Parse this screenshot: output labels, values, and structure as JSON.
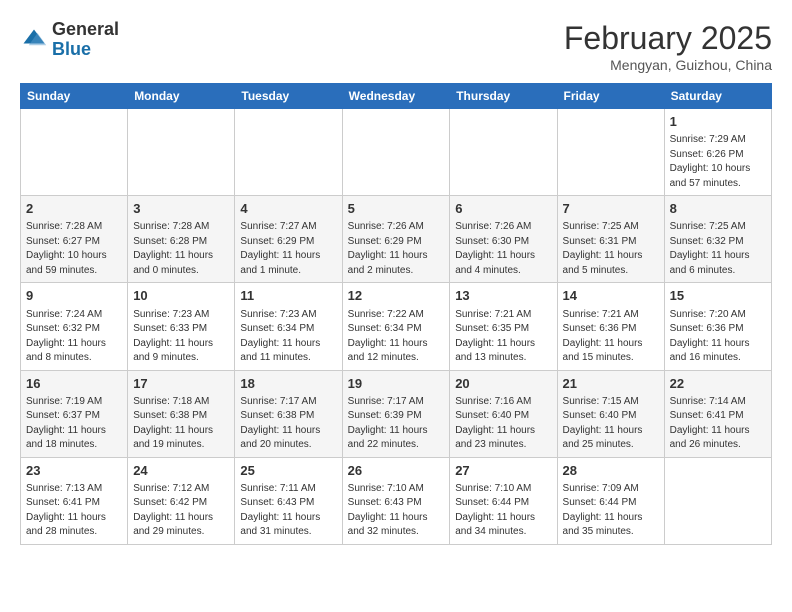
{
  "header": {
    "logo_general": "General",
    "logo_blue": "Blue",
    "title": "February 2025",
    "subtitle": "Mengyan, Guizhou, China"
  },
  "weekdays": [
    "Sunday",
    "Monday",
    "Tuesday",
    "Wednesday",
    "Thursday",
    "Friday",
    "Saturday"
  ],
  "weeks": [
    [
      {
        "day": "",
        "info": ""
      },
      {
        "day": "",
        "info": ""
      },
      {
        "day": "",
        "info": ""
      },
      {
        "day": "",
        "info": ""
      },
      {
        "day": "",
        "info": ""
      },
      {
        "day": "",
        "info": ""
      },
      {
        "day": "1",
        "info": "Sunrise: 7:29 AM\nSunset: 6:26 PM\nDaylight: 10 hours and 57 minutes."
      }
    ],
    [
      {
        "day": "2",
        "info": "Sunrise: 7:28 AM\nSunset: 6:27 PM\nDaylight: 10 hours and 59 minutes."
      },
      {
        "day": "3",
        "info": "Sunrise: 7:28 AM\nSunset: 6:28 PM\nDaylight: 11 hours and 0 minutes."
      },
      {
        "day": "4",
        "info": "Sunrise: 7:27 AM\nSunset: 6:29 PM\nDaylight: 11 hours and 1 minute."
      },
      {
        "day": "5",
        "info": "Sunrise: 7:26 AM\nSunset: 6:29 PM\nDaylight: 11 hours and 2 minutes."
      },
      {
        "day": "6",
        "info": "Sunrise: 7:26 AM\nSunset: 6:30 PM\nDaylight: 11 hours and 4 minutes."
      },
      {
        "day": "7",
        "info": "Sunrise: 7:25 AM\nSunset: 6:31 PM\nDaylight: 11 hours and 5 minutes."
      },
      {
        "day": "8",
        "info": "Sunrise: 7:25 AM\nSunset: 6:32 PM\nDaylight: 11 hours and 6 minutes."
      }
    ],
    [
      {
        "day": "9",
        "info": "Sunrise: 7:24 AM\nSunset: 6:32 PM\nDaylight: 11 hours and 8 minutes."
      },
      {
        "day": "10",
        "info": "Sunrise: 7:23 AM\nSunset: 6:33 PM\nDaylight: 11 hours and 9 minutes."
      },
      {
        "day": "11",
        "info": "Sunrise: 7:23 AM\nSunset: 6:34 PM\nDaylight: 11 hours and 11 minutes."
      },
      {
        "day": "12",
        "info": "Sunrise: 7:22 AM\nSunset: 6:34 PM\nDaylight: 11 hours and 12 minutes."
      },
      {
        "day": "13",
        "info": "Sunrise: 7:21 AM\nSunset: 6:35 PM\nDaylight: 11 hours and 13 minutes."
      },
      {
        "day": "14",
        "info": "Sunrise: 7:21 AM\nSunset: 6:36 PM\nDaylight: 11 hours and 15 minutes."
      },
      {
        "day": "15",
        "info": "Sunrise: 7:20 AM\nSunset: 6:36 PM\nDaylight: 11 hours and 16 minutes."
      }
    ],
    [
      {
        "day": "16",
        "info": "Sunrise: 7:19 AM\nSunset: 6:37 PM\nDaylight: 11 hours and 18 minutes."
      },
      {
        "day": "17",
        "info": "Sunrise: 7:18 AM\nSunset: 6:38 PM\nDaylight: 11 hours and 19 minutes."
      },
      {
        "day": "18",
        "info": "Sunrise: 7:17 AM\nSunset: 6:38 PM\nDaylight: 11 hours and 20 minutes."
      },
      {
        "day": "19",
        "info": "Sunrise: 7:17 AM\nSunset: 6:39 PM\nDaylight: 11 hours and 22 minutes."
      },
      {
        "day": "20",
        "info": "Sunrise: 7:16 AM\nSunset: 6:40 PM\nDaylight: 11 hours and 23 minutes."
      },
      {
        "day": "21",
        "info": "Sunrise: 7:15 AM\nSunset: 6:40 PM\nDaylight: 11 hours and 25 minutes."
      },
      {
        "day": "22",
        "info": "Sunrise: 7:14 AM\nSunset: 6:41 PM\nDaylight: 11 hours and 26 minutes."
      }
    ],
    [
      {
        "day": "23",
        "info": "Sunrise: 7:13 AM\nSunset: 6:41 PM\nDaylight: 11 hours and 28 minutes."
      },
      {
        "day": "24",
        "info": "Sunrise: 7:12 AM\nSunset: 6:42 PM\nDaylight: 11 hours and 29 minutes."
      },
      {
        "day": "25",
        "info": "Sunrise: 7:11 AM\nSunset: 6:43 PM\nDaylight: 11 hours and 31 minutes."
      },
      {
        "day": "26",
        "info": "Sunrise: 7:10 AM\nSunset: 6:43 PM\nDaylight: 11 hours and 32 minutes."
      },
      {
        "day": "27",
        "info": "Sunrise: 7:10 AM\nSunset: 6:44 PM\nDaylight: 11 hours and 34 minutes."
      },
      {
        "day": "28",
        "info": "Sunrise: 7:09 AM\nSunset: 6:44 PM\nDaylight: 11 hours and 35 minutes."
      },
      {
        "day": "",
        "info": ""
      }
    ]
  ]
}
